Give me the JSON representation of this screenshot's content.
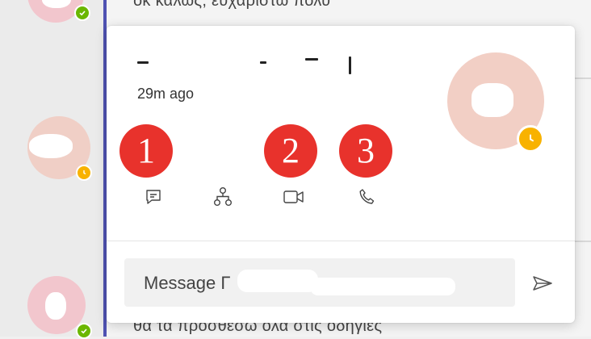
{
  "background_chat": {
    "message_above": "οκ καλώς, ευχαριστώ πολύ",
    "message_below": "θα τα προσθέσω όλα στις οδηγίες"
  },
  "contact_card": {
    "last_seen": "29m ago",
    "presence": "away",
    "annotations": [
      "1",
      "2",
      "3"
    ],
    "actions": [
      {
        "icon": "chat-icon"
      },
      {
        "icon": "org-chart-icon"
      },
      {
        "icon": "video-call-icon"
      },
      {
        "icon": "phone-call-icon"
      }
    ],
    "compose": {
      "placeholder": "Message Γ",
      "send_icon": "send-icon"
    }
  },
  "colors": {
    "accent_bar": "#4f52b2",
    "away": "#f8b200",
    "available": "#6bb700",
    "marker": "#e8322c"
  }
}
